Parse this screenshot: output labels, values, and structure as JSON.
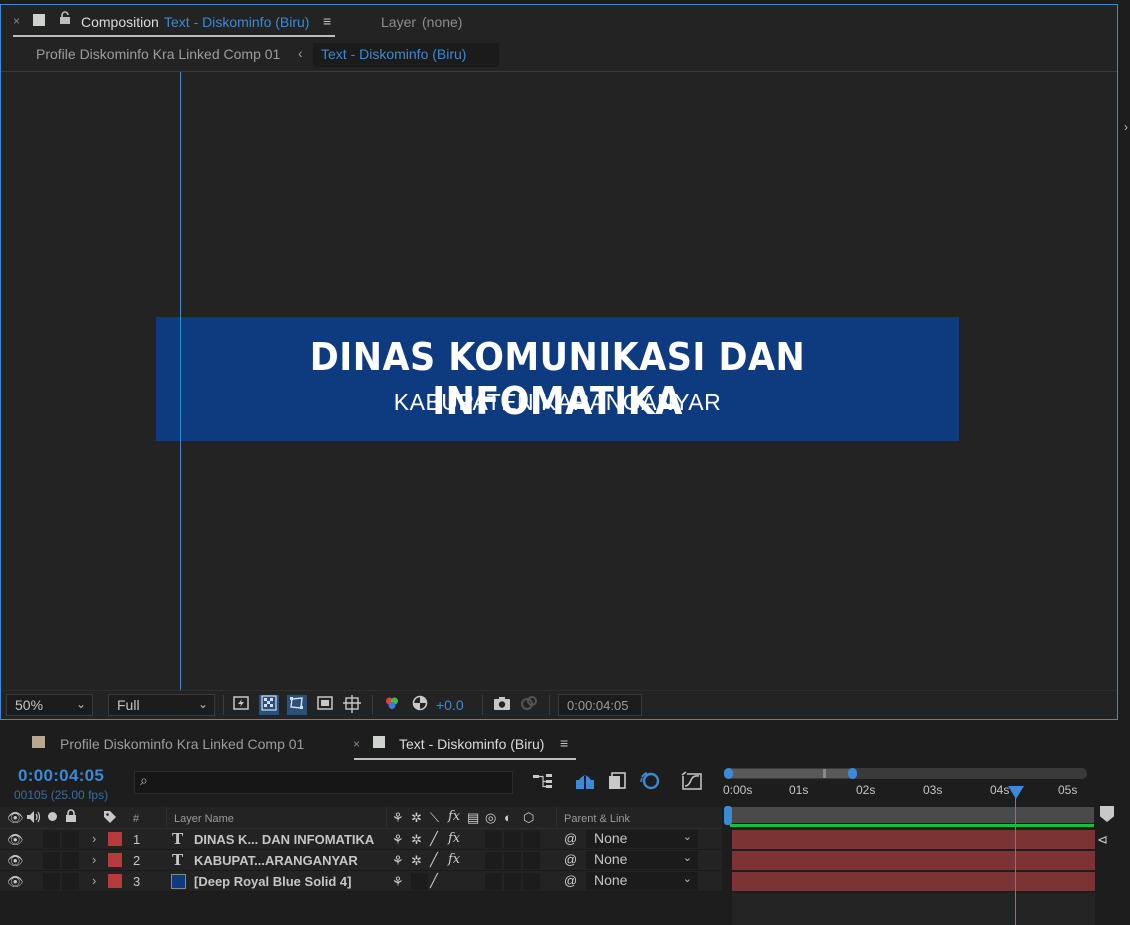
{
  "composition_panel": {
    "tab_title_prefix": "Composition",
    "tab_title_comp": "Text - Diskominfo (Biru)",
    "layer_tab_label": "Layer",
    "layer_tab_value": "(none)",
    "breadcrumb": [
      "Profile Diskominfo Kra Linked Comp 01",
      "Text - Diskominfo (Biru)"
    ],
    "breadcrumb_separator": "‹"
  },
  "viewer": {
    "banner_title": "DINAS KOMUNIKASI DAN INFOMATIKA",
    "banner_subtitle": "KABUPATEN KARANGANYAR",
    "banner_color": "#0e3b7f",
    "guide_color": "#3b8ad6"
  },
  "viewer_toolbar": {
    "zoom": "50%",
    "resolution": "Full",
    "exposure": "+0.0",
    "current_time": "0:00:04:05",
    "icons": [
      "fast-preview-icon",
      "transparency-grid-icon",
      "mask-path-icon",
      "region-of-interest-icon",
      "grid-guides-icon",
      "channel-icon",
      "exposure-reset-icon",
      "snapshot-icon",
      "show-snapshot-icon"
    ]
  },
  "timeline_panel": {
    "tabs": [
      "Profile Diskominfo Kra Linked Comp 01",
      "Text - Diskominfo (Biru)"
    ],
    "timecode": "0:00:04:05",
    "frames_info": "00105 (25.00 fps)",
    "search_placeholder": "",
    "column_headers": {
      "number": "#",
      "layer_name": "Layer Name",
      "parent_link": "Parent & Link"
    },
    "layers": [
      {
        "number": "1",
        "type_icon": "T",
        "name": "DINAS K... DAN INFOMATIKA",
        "label_color": "#b83b3b",
        "parent": "None"
      },
      {
        "number": "2",
        "type_icon": "T",
        "name": "KABUPAT...ARANGANYAR",
        "label_color": "#b83b3b",
        "parent": "None"
      },
      {
        "number": "3",
        "type_icon": "solid",
        "name": "[Deep Royal Blue Solid 4]",
        "label_color": "#b83b3b",
        "parent": "None"
      }
    ],
    "ruler_labels": [
      "0:00s",
      "01s",
      "02s",
      "03s",
      "04s",
      "05s"
    ],
    "accent_color": "#3b8ad6",
    "layer_bar_color": "#7c3333"
  }
}
